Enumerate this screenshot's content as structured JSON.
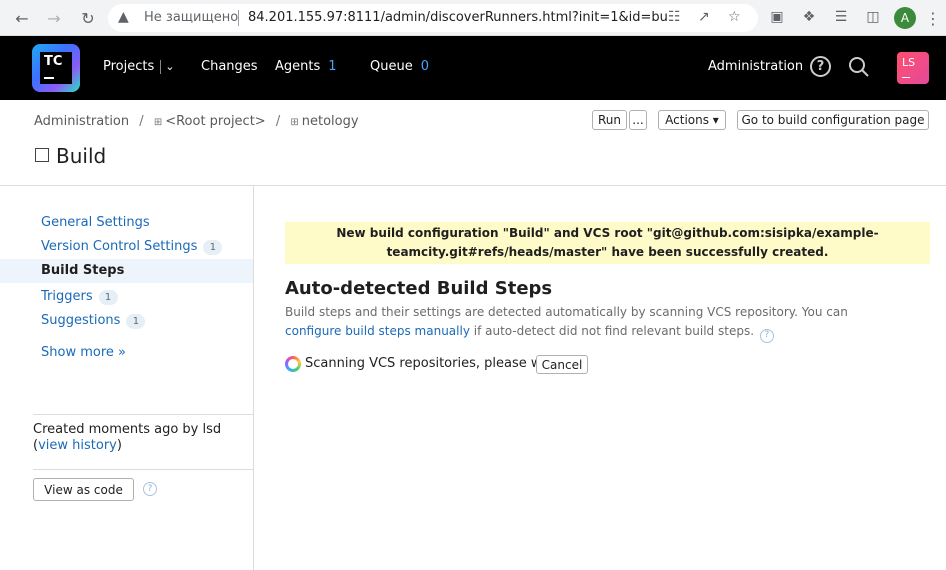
{
  "browser": {
    "insecure_label": "Не защищено",
    "url": "84.201.155.97:8111/admin/discoverRunners.html?init=1&id=bu...",
    "profile_letter": "A"
  },
  "header": {
    "logo_text": "TC",
    "nav": {
      "projects": "Projects",
      "changes": "Changes",
      "agents": "Agents",
      "agents_count": "1",
      "queue": "Queue",
      "queue_count": "0"
    },
    "administration": "Administration",
    "avatar_initials": "LS"
  },
  "breadcrumb": {
    "admin": "Administration",
    "sep": "/",
    "root": "<Root project>",
    "project": "netology"
  },
  "toolbar": {
    "run": "Run",
    "run_more": "...",
    "actions": "Actions ▾",
    "go_to": "Go to build configuration page"
  },
  "page_title": "Build",
  "sidebar": {
    "items": [
      {
        "label": "General Settings",
        "badge": ""
      },
      {
        "label": "Version Control Settings",
        "badge": "1"
      },
      {
        "label": "Build Steps",
        "badge": ""
      },
      {
        "label": "Triggers",
        "badge": "1"
      },
      {
        "label": "Suggestions",
        "badge": "1"
      }
    ],
    "show_more": "Show more »",
    "created_prefix": "Created moments ago by lsd",
    "view_history_open": "(",
    "view_history": "view history",
    "view_history_close": ")",
    "view_as_code": "View as code"
  },
  "main": {
    "notice_line1": "New build configuration \"Build\" and VCS root \"git@github.com:sisipka/example-",
    "notice_line2": "teamcity.git#refs/heads/master\" have been successfully created.",
    "heading": "Auto-detected Build Steps",
    "desc_text": "Build steps and their settings are detected automatically by scanning VCS repository. You can ",
    "desc_link": "configure build steps manually",
    "desc_tail": " if auto-detect did not find relevant build steps.",
    "scanning": "Scanning VCS repositories, please wait...",
    "cancel": "Cancel"
  },
  "colors": {
    "link": "#1a6ab8",
    "notice_bg": "#fffbc8",
    "header_bg": "#000000",
    "count": "#4aa3ff"
  }
}
